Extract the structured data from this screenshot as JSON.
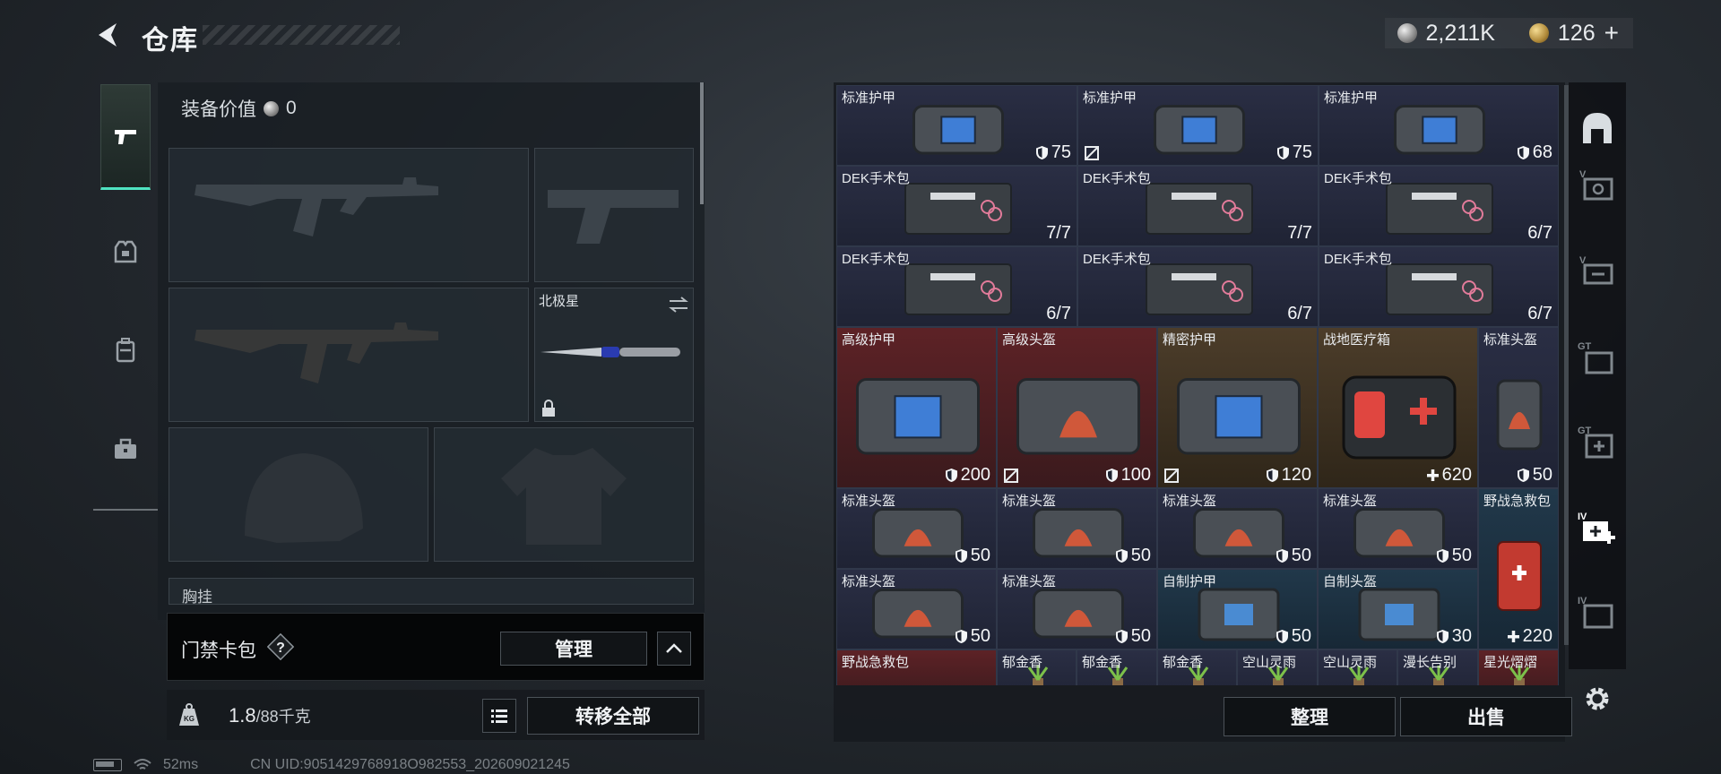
{
  "header": {
    "title": "仓库"
  },
  "currency": {
    "silver": "2,211K",
    "gold": "126",
    "gold_add": "+"
  },
  "left_rail": [
    "weapon-icon",
    "armor-icon",
    "backpack-icon",
    "toolbox-icon"
  ],
  "equipment": {
    "value_label": "装备价值",
    "value": "0",
    "melee_name": "北极星",
    "chest_label": "胸挂"
  },
  "card_pack": {
    "label": "门禁卡包",
    "help": "?",
    "manage": "管理"
  },
  "weight": {
    "current": "1.8",
    "max": "/88千克"
  },
  "transfer_all": "转移全部",
  "status": {
    "ping": "52ms",
    "uid": "CN UID:9051429768918O982553_202609021245"
  },
  "grid_items": [
    {
      "name": "标准护甲",
      "value": "75",
      "type": "shield",
      "bg": "blue",
      "art": "armor",
      "mark": false
    },
    {
      "name": "标准护甲",
      "value": "75",
      "type": "shield",
      "bg": "blue",
      "art": "armor",
      "mark": true
    },
    {
      "name": "标准护甲",
      "value": "68",
      "type": "shield",
      "bg": "blue",
      "art": "armor",
      "mark": false
    },
    {
      "name": "DEK手术包",
      "value": "7/7",
      "type": "count",
      "bg": "blue",
      "art": "kit",
      "mark": false
    },
    {
      "name": "DEK手术包",
      "value": "7/7",
      "type": "count",
      "bg": "blue",
      "art": "kit",
      "mark": false
    },
    {
      "name": "DEK手术包",
      "value": "6/7",
      "type": "count",
      "bg": "blue",
      "art": "kit",
      "mark": false
    },
    {
      "name": "DEK手术包",
      "value": "6/7",
      "type": "count",
      "bg": "blue",
      "art": "kit",
      "mark": false
    },
    {
      "name": "DEK手术包",
      "value": "6/7",
      "type": "count",
      "bg": "blue",
      "art": "kit",
      "mark": false
    },
    {
      "name": "DEK手术包",
      "value": "6/7",
      "type": "count",
      "bg": "blue",
      "art": "kit",
      "mark": false
    },
    {
      "name": "高级护甲",
      "value": "200",
      "type": "shield",
      "bg": "red",
      "art": "armor-big",
      "mark": false
    },
    {
      "name": "高级头盔",
      "value": "100",
      "type": "shield",
      "bg": "red",
      "art": "helmet-big",
      "mark": true
    },
    {
      "name": "精密护甲",
      "value": "120",
      "type": "shield",
      "bg": "gold",
      "art": "armor-big",
      "mark": true
    },
    {
      "name": "战地医疗箱",
      "value": "620",
      "type": "heal",
      "bg": "gold",
      "art": "medbox",
      "mark": false
    },
    {
      "name": "标准头盔",
      "value": "50",
      "type": "shield",
      "bg": "blue",
      "art": "helmet-side",
      "mark": false
    },
    {
      "name": "标准头盔",
      "value": "50",
      "type": "shield",
      "bg": "blue",
      "art": "helmet",
      "mark": false
    },
    {
      "name": "标准头盔",
      "value": "50",
      "type": "shield",
      "bg": "blue",
      "art": "helmet",
      "mark": false
    },
    {
      "name": "标准头盔",
      "value": "50",
      "type": "shield",
      "bg": "blue",
      "art": "helmet",
      "mark": false
    },
    {
      "name": "标准头盔",
      "value": "50",
      "type": "shield",
      "bg": "blue",
      "art": "helmet",
      "mark": false
    },
    {
      "name": "野战急救包",
      "value": "220",
      "type": "heal",
      "bg": "teal",
      "art": "firstaid",
      "mark": false
    },
    {
      "name": "标准头盔",
      "value": "50",
      "type": "shield",
      "bg": "blue",
      "art": "helmet",
      "mark": false
    },
    {
      "name": "标准头盔",
      "value": "50",
      "type": "shield",
      "bg": "blue",
      "art": "helmet",
      "mark": false
    },
    {
      "name": "自制护甲",
      "value": "50",
      "type": "shield",
      "bg": "teal",
      "art": "crate",
      "mark": false
    },
    {
      "name": "自制头盔",
      "value": "30",
      "type": "shield",
      "bg": "teal",
      "art": "crate",
      "mark": false
    },
    {
      "name": "野战急救包",
      "value": "",
      "type": "none",
      "bg": "red",
      "art": "none",
      "mark": false
    },
    {
      "name": "郁金香",
      "value": "",
      "type": "none",
      "bg": "blue",
      "art": "plant",
      "mark": false
    },
    {
      "name": "郁金香",
      "value": "",
      "type": "none",
      "bg": "blue",
      "art": "plant",
      "mark": false
    },
    {
      "name": "郁金香",
      "value": "",
      "type": "none",
      "bg": "blue",
      "art": "plant",
      "mark": false
    },
    {
      "name": "空山灵雨",
      "value": "",
      "type": "none",
      "bg": "blue",
      "art": "plant",
      "mark": false
    },
    {
      "name": "空山灵雨",
      "value": "",
      "type": "none",
      "bg": "blue",
      "art": "plant",
      "mark": false
    },
    {
      "name": "漫长告别",
      "value": "",
      "type": "none",
      "bg": "blue",
      "art": "plant",
      "mark": false
    },
    {
      "name": "星光熠熠",
      "value": "",
      "type": "none",
      "bg": "red",
      "art": "plant",
      "mark": false
    }
  ],
  "right_rail": [
    "helmet-category-icon",
    "v-armor-category-icon",
    "v-rig-category-icon",
    "gt-backpack-category-icon",
    "gt-medkit-category-icon",
    "iv-heal-category-icon",
    "iv-misc-category-icon"
  ],
  "actions": {
    "sort": "整理",
    "sell": "出售"
  },
  "colors": {
    "accent": "#4fe3c1",
    "red_rarity": "#5d2226",
    "gold_rarity": "#4c3d2a",
    "blue_rarity": "#2a2e44"
  }
}
